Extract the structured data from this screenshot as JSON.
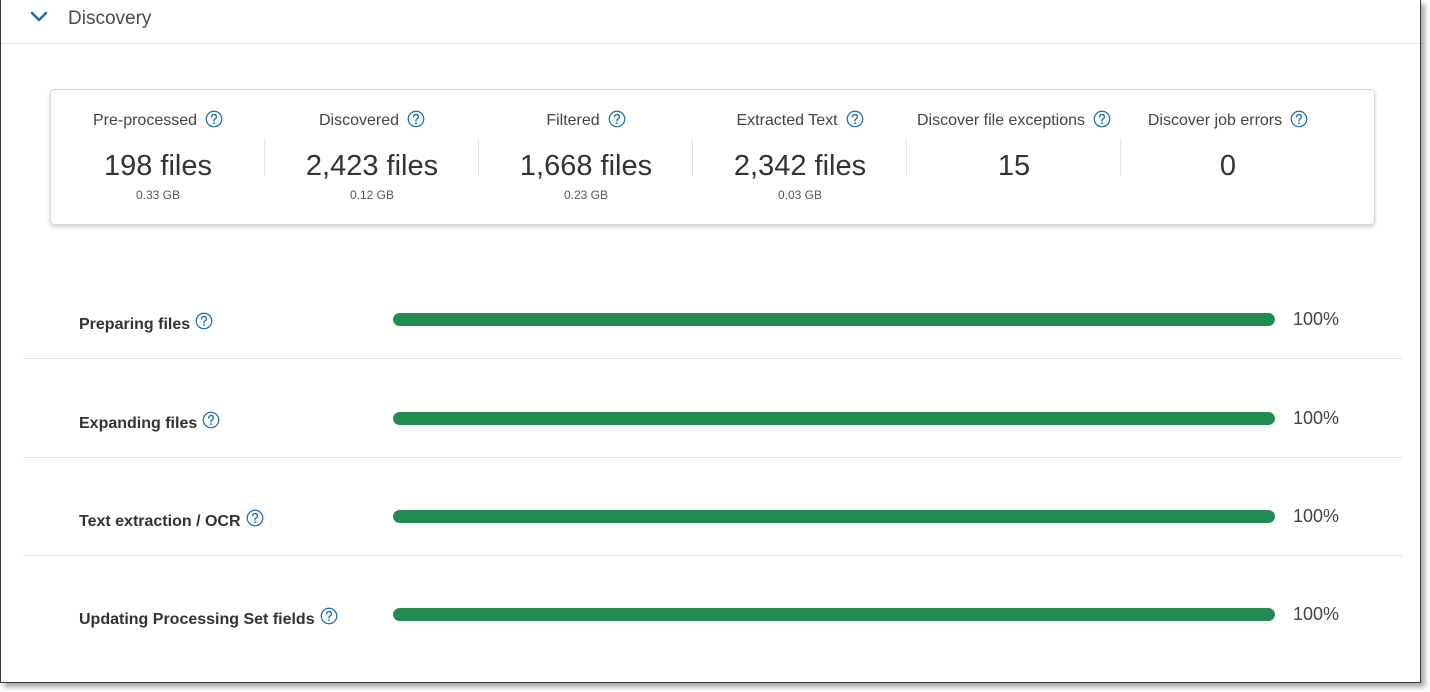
{
  "section": {
    "title": "Discovery",
    "expanded": true,
    "toggle_icon": "chevron-down-icon"
  },
  "summary": [
    {
      "label": "Pre-processed",
      "value": "198 files",
      "size": "0.33 GB"
    },
    {
      "label": "Discovered",
      "value": "2,423 files",
      "size": "0.12 GB"
    },
    {
      "label": "Filtered",
      "value": "1,668 files",
      "size": "0.23 GB"
    },
    {
      "label": "Extracted Text",
      "value": "2,342 files",
      "size": "0.03 GB"
    },
    {
      "label": "Discover file exceptions",
      "value": "15",
      "size": ""
    },
    {
      "label": "Discover job errors",
      "value": "0",
      "size": ""
    }
  ],
  "progress": [
    {
      "label": "Preparing files",
      "percent": 100,
      "percent_text": "100%"
    },
    {
      "label": "Expanding files",
      "percent": 100,
      "percent_text": "100%"
    },
    {
      "label": "Text extraction / OCR",
      "percent": 100,
      "percent_text": "100%"
    },
    {
      "label": "Updating Processing Set fields",
      "percent": 100,
      "percent_text": "100%"
    }
  ],
  "colors": {
    "accent": "#1a6fb5",
    "progress_fill": "#208b52",
    "progress_track": "#e6e6e6"
  },
  "icons": {
    "help": "help-circle-icon"
  }
}
